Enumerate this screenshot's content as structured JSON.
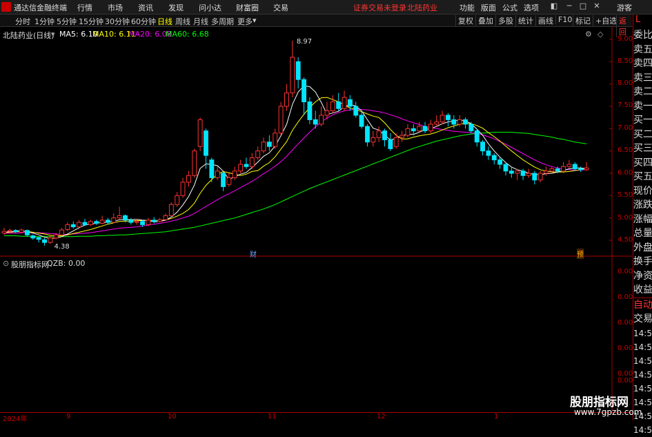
{
  "app": {
    "title": "通达信金融终端",
    "menu": [
      "行情",
      "市场",
      "资讯",
      "发现",
      "问小达",
      "财富圈",
      "交易"
    ],
    "notice": "证券交易未登录",
    "stock_name_top": "北陆药业",
    "right_menu": [
      "功能",
      "版面",
      "公式",
      "选项"
    ],
    "user": "游客"
  },
  "periods": [
    "分时",
    "1分钟",
    "5分钟",
    "15分钟",
    "30分钟",
    "60分钟",
    "日线",
    "周线",
    "月线",
    "多周期",
    "更多"
  ],
  "active_period": "日线",
  "tools": [
    "复权",
    "叠加",
    "多股",
    "统计",
    "画线",
    "F10",
    "标记",
    "+自选",
    "返回"
  ],
  "main_legend": {
    "title": "北陆药业(日线)",
    "ma5": "MA5: 6.10",
    "ma10": "MA10: 6.11",
    "ma20": "MA20: 6.08",
    "ma60": "MA60: 6.68"
  },
  "annotations": {
    "high": "8.97",
    "low": "4.38",
    "fin_mark": "财",
    "pre_mark": "预"
  },
  "price_axis": [
    "9.00",
    "8.50",
    "8.00",
    "7.50",
    "7.00",
    "6.50",
    "6.00",
    "5.50",
    "5.00",
    "4.50"
  ],
  "sub_legend": {
    "title": "股朋指标网",
    "qzb": "QZB: 0.00"
  },
  "sub_axis": [
    "0.00",
    "0.00",
    "0.00",
    "0.00",
    "0.00",
    "0.00"
  ],
  "x_axis": [
    "2024年",
    "9",
    "10",
    "11",
    "12",
    "1"
  ],
  "right_panel": {
    "head": "L",
    "items": [
      "委比",
      "卖五",
      "卖四",
      "卖三",
      "卖二",
      "卖一",
      "买一",
      "买二",
      "买三",
      "买四",
      "买五",
      "现价",
      "涨跌",
      "涨幅",
      "总量",
      "外盘",
      "换手",
      "净资",
      "收益"
    ],
    "auto": "自动",
    "trade": "交易",
    "times": [
      "14:56",
      "14:56",
      "14:56",
      "14:56",
      "14:56",
      "14:56",
      "14:56",
      "14:56"
    ]
  },
  "watermark": {
    "line1": "股朋指标网",
    "line2": "www.7gpzb.com"
  },
  "colors": {
    "up": "#ff3333",
    "down": "#00e5ff",
    "ma5": "#ffffff",
    "ma10": "#ffff00",
    "ma20": "#ff00ff",
    "ma60": "#00ff00",
    "axis": "#aa0000"
  },
  "chart_data": {
    "type": "candlestick",
    "ylim": [
      4.3,
      9.1
    ],
    "candles": [
      [
        4.66,
        4.7,
        4.78,
        4.62
      ],
      [
        4.7,
        4.72,
        4.76,
        4.65
      ],
      [
        4.72,
        4.69,
        4.75,
        4.66
      ],
      [
        4.68,
        4.73,
        4.76,
        4.65
      ],
      [
        4.72,
        4.62,
        4.74,
        4.58
      ],
      [
        4.6,
        4.55,
        4.63,
        4.51
      ],
      [
        4.56,
        4.52,
        4.58,
        4.45
      ],
      [
        4.51,
        4.45,
        4.55,
        4.38
      ],
      [
        4.45,
        4.55,
        4.6,
        4.42
      ],
      [
        4.55,
        4.62,
        4.66,
        4.52
      ],
      [
        4.62,
        4.73,
        4.78,
        4.6
      ],
      [
        4.74,
        4.85,
        4.9,
        4.7
      ],
      [
        4.85,
        4.8,
        4.92,
        4.76
      ],
      [
        4.8,
        4.9,
        4.95,
        4.78
      ],
      [
        4.9,
        4.85,
        4.98,
        4.82
      ],
      [
        4.85,
        4.92,
        4.96,
        4.82
      ],
      [
        4.92,
        4.88,
        4.96,
        4.84
      ],
      [
        4.88,
        4.95,
        5.05,
        4.86
      ],
      [
        4.95,
        4.9,
        5.0,
        4.85
      ],
      [
        4.9,
        5.0,
        5.1,
        4.88
      ],
      [
        5.0,
        5.05,
        5.25,
        4.98
      ],
      [
        5.05,
        4.95,
        5.08,
        4.9
      ],
      [
        4.95,
        4.9,
        5.0,
        4.85
      ],
      [
        4.9,
        4.92,
        4.98,
        4.85
      ],
      [
        4.92,
        4.85,
        4.95,
        4.8
      ],
      [
        4.85,
        4.95,
        5.0,
        4.82
      ],
      [
        4.95,
        4.92,
        5.02,
        4.88
      ],
      [
        4.92,
        4.96,
        5.0,
        4.9
      ],
      [
        4.96,
        5.05,
        5.1,
        4.93
      ],
      [
        5.05,
        5.3,
        5.35,
        5.02
      ],
      [
        5.3,
        5.5,
        5.58,
        5.25
      ],
      [
        5.5,
        5.8,
        5.9,
        5.45
      ],
      [
        5.8,
        5.95,
        6.05,
        5.7
      ],
      [
        5.95,
        6.5,
        6.55,
        5.9
      ],
      [
        6.6,
        7.2,
        7.25,
        6.5
      ],
      [
        6.95,
        6.4,
        7.0,
        6.1
      ],
      [
        6.3,
        5.9,
        6.35,
        5.8
      ],
      [
        5.9,
        6.05,
        6.15,
        5.85
      ],
      [
        6.0,
        5.7,
        6.05,
        5.6
      ],
      [
        5.75,
        5.9,
        6.0,
        5.7
      ],
      [
        5.9,
        6.05,
        6.15,
        5.85
      ],
      [
        6.05,
        6.2,
        6.3,
        6.0
      ],
      [
        6.2,
        6.15,
        6.35,
        6.1
      ],
      [
        6.15,
        6.35,
        6.45,
        6.1
      ],
      [
        6.35,
        6.5,
        6.6,
        6.3
      ],
      [
        6.5,
        6.7,
        6.8,
        6.45
      ],
      [
        6.7,
        6.6,
        6.85,
        6.5
      ],
      [
        6.6,
        6.9,
        7.0,
        6.55
      ],
      [
        6.9,
        7.5,
        7.6,
        6.85
      ],
      [
        7.5,
        7.8,
        8.0,
        7.4
      ],
      [
        7.8,
        8.6,
        8.97,
        7.7
      ],
      [
        8.5,
        8.1,
        8.6,
        7.9
      ],
      [
        8.1,
        7.6,
        8.15,
        7.3
      ],
      [
        7.6,
        7.2,
        7.7,
        7.1
      ],
      [
        7.2,
        7.1,
        7.4,
        7.0
      ],
      [
        7.1,
        7.3,
        7.5,
        7.05
      ],
      [
        7.3,
        7.4,
        7.6,
        7.2
      ],
      [
        7.4,
        7.6,
        7.75,
        7.35
      ],
      [
        7.6,
        7.45,
        7.8,
        7.4
      ],
      [
        7.45,
        7.7,
        7.85,
        7.4
      ],
      [
        7.65,
        7.5,
        7.75,
        7.4
      ],
      [
        7.5,
        7.3,
        7.6,
        7.25
      ],
      [
        7.3,
        7.05,
        7.4,
        7.0
      ],
      [
        7.05,
        6.7,
        7.1,
        6.6
      ],
      [
        6.7,
        6.8,
        6.95,
        6.6
      ],
      [
        6.8,
        6.95,
        7.05,
        6.7
      ],
      [
        6.95,
        6.75,
        7.0,
        6.6
      ],
      [
        6.75,
        6.55,
        6.9,
        6.5
      ],
      [
        6.6,
        6.8,
        6.9,
        6.55
      ],
      [
        6.8,
        6.85,
        6.95,
        6.7
      ],
      [
        6.85,
        7.0,
        7.1,
        6.8
      ],
      [
        7.0,
        6.95,
        7.1,
        6.85
      ],
      [
        6.95,
        7.05,
        7.15,
        6.9
      ],
      [
        7.05,
        6.95,
        7.15,
        6.9
      ],
      [
        6.95,
        7.1,
        7.2,
        6.9
      ],
      [
        7.1,
        7.15,
        7.3,
        7.05
      ],
      [
        7.15,
        7.3,
        7.4,
        7.1
      ],
      [
        7.3,
        7.2,
        7.35,
        7.05
      ],
      [
        7.2,
        7.1,
        7.3,
        7.0
      ],
      [
        7.1,
        7.2,
        7.3,
        7.05
      ],
      [
        7.2,
        7.1,
        7.25,
        7.0
      ],
      [
        7.1,
        6.95,
        7.15,
        6.9
      ],
      [
        6.95,
        6.7,
        7.0,
        6.6
      ],
      [
        6.7,
        6.5,
        6.75,
        6.4
      ],
      [
        6.5,
        6.4,
        6.6,
        6.3
      ],
      [
        6.4,
        6.3,
        6.45,
        6.2
      ],
      [
        6.3,
        6.2,
        6.35,
        6.1
      ],
      [
        6.2,
        6.05,
        6.25,
        5.95
      ],
      [
        6.05,
        6.0,
        6.15,
        5.9
      ],
      [
        6.0,
        6.05,
        6.1,
        5.85
      ],
      [
        6.05,
        5.95,
        6.1,
        5.85
      ],
      [
        5.95,
        6.0,
        6.1,
        5.9
      ],
      [
        6.0,
        5.85,
        6.05,
        5.75
      ],
      [
        5.85,
        6.0,
        6.05,
        5.8
      ],
      [
        6.0,
        6.05,
        6.15,
        5.95
      ],
      [
        6.05,
        6.1,
        6.15,
        6.0
      ],
      [
        6.1,
        6.05,
        6.15,
        6.0
      ],
      [
        6.05,
        6.15,
        6.25,
        6.0
      ],
      [
        6.15,
        6.2,
        6.3,
        6.1
      ],
      [
        6.2,
        6.1,
        6.25,
        6.05
      ],
      [
        6.1,
        6.08,
        6.15,
        6.03
      ],
      [
        6.08,
        6.12,
        6.25,
        6.05
      ]
    ],
    "ma5": [
      4.68,
      4.69,
      4.7,
      4.71,
      4.69,
      4.66,
      4.62,
      4.57,
      4.54,
      4.55,
      4.58,
      4.64,
      4.71,
      4.78,
      4.84,
      4.86,
      4.88,
      4.9,
      4.9,
      4.92,
      4.96,
      4.97,
      4.96,
      4.97,
      4.95,
      4.94,
      4.91,
      4.92,
      4.95,
      5.02,
      5.13,
      5.29,
      5.48,
      5.74,
      6.11,
      6.21,
      6.2,
      6.17,
      6.05,
      5.86,
      5.92,
      5.98,
      6.02,
      6.13,
      6.25,
      6.38,
      6.46,
      6.61,
      6.84,
      7.1,
      7.54,
      7.82,
      7.96,
      7.94,
      7.82,
      7.59,
      7.32,
      7.35,
      7.39,
      7.49,
      7.54,
      7.51,
      7.4,
      7.2,
      7.01,
      6.97,
      6.85,
      6.75,
      6.78,
      6.84,
      6.88,
      6.87,
      6.92,
      6.98,
      7.0,
      7.05,
      7.11,
      7.15,
      7.17,
      7.19,
      7.18,
      7.11,
      6.99,
      6.85,
      6.66,
      6.5,
      6.36,
      6.24,
      6.14,
      6.08,
      6.05,
      6.0,
      5.97,
      5.97,
      5.99,
      6.0,
      6.03,
      6.06,
      6.1,
      6.12,
      6.12,
      6.1
    ],
    "ma10": [
      4.67,
      4.68,
      4.69,
      4.7,
      4.7,
      4.68,
      4.66,
      4.64,
      4.61,
      4.6,
      4.6,
      4.62,
      4.65,
      4.68,
      4.71,
      4.74,
      4.78,
      4.82,
      4.86,
      4.89,
      4.92,
      4.93,
      4.93,
      4.94,
      4.94,
      4.95,
      4.94,
      4.94,
      4.95,
      4.99,
      5.04,
      5.1,
      5.19,
      5.33,
      5.55,
      5.73,
      5.86,
      5.98,
      6.04,
      6.01,
      5.98,
      5.95,
      5.98,
      6.04,
      6.06,
      6.16,
      6.24,
      6.37,
      6.54,
      6.71,
      6.96,
      7.15,
      7.32,
      7.47,
      7.6,
      7.69,
      7.7,
      7.65,
      7.6,
      7.53,
      7.46,
      7.43,
      7.38,
      7.33,
      7.28,
      7.25,
      7.13,
      6.98,
      6.85,
      6.77,
      6.77,
      6.81,
      6.84,
      6.86,
      6.88,
      6.92,
      6.97,
      7.02,
      7.06,
      7.1,
      7.12,
      7.11,
      7.07,
      7.01,
      6.91,
      6.82,
      6.72,
      6.61,
      6.5,
      6.4,
      6.3,
      6.22,
      6.14,
      6.08,
      6.05,
      6.03,
      6.03,
      6.03,
      6.04,
      6.06,
      6.08,
      6.11
    ],
    "ma20": [
      4.65,
      4.66,
      4.66,
      4.67,
      4.67,
      4.67,
      4.67,
      4.66,
      4.65,
      4.64,
      4.63,
      4.63,
      4.64,
      4.65,
      4.66,
      4.67,
      4.69,
      4.71,
      4.73,
      4.75,
      4.77,
      4.78,
      4.79,
      4.8,
      4.82,
      4.84,
      4.86,
      4.88,
      4.9,
      4.93,
      4.96,
      5.0,
      5.04,
      5.1,
      5.18,
      5.26,
      5.33,
      5.41,
      5.48,
      5.54,
      5.61,
      5.68,
      5.75,
      5.82,
      5.9,
      5.99,
      6.07,
      6.16,
      6.26,
      6.38,
      6.52,
      6.66,
      6.79,
      6.92,
      7.04,
      7.15,
      7.24,
      7.31,
      7.36,
      7.4,
      7.42,
      7.43,
      7.43,
      7.42,
      7.4,
      7.38,
      7.35,
      7.31,
      7.27,
      7.22,
      7.17,
      7.13,
      7.09,
      7.05,
      7.02,
      7.0,
      6.98,
      6.96,
      6.94,
      6.93,
      6.92,
      6.91,
      6.89,
      6.86,
      6.82,
      6.77,
      6.71,
      6.65,
      6.58,
      6.51,
      6.44,
      6.37,
      6.3,
      6.24,
      6.19,
      6.15,
      6.12,
      6.09,
      6.08,
      6.07,
      6.07,
      6.08
    ],
    "ma60": [
      4.6,
      4.6,
      4.6,
      4.59,
      4.59,
      4.59,
      4.58,
      4.58,
      4.58,
      4.58,
      4.58,
      4.58,
      4.58,
      4.59,
      4.59,
      4.59,
      4.6,
      4.6,
      4.61,
      4.61,
      4.62,
      4.62,
      4.63,
      4.64,
      4.65,
      4.66,
      4.67,
      4.68,
      4.69,
      4.71,
      4.73,
      4.75,
      4.77,
      4.79,
      4.82,
      4.85,
      4.88,
      4.91,
      4.94,
      4.97,
      5.0,
      5.04,
      5.08,
      5.12,
      5.16,
      5.2,
      5.25,
      5.3,
      5.36,
      5.42,
      5.48,
      5.54,
      5.6,
      5.66,
      5.71,
      5.76,
      5.81,
      5.86,
      5.91,
      5.96,
      6.01,
      6.06,
      6.11,
      6.16,
      6.21,
      6.26,
      6.31,
      6.36,
      6.41,
      6.46,
      6.51,
      6.56,
      6.6,
      6.64,
      6.68,
      6.72,
      6.75,
      6.78,
      6.81,
      6.84,
      6.86,
      6.88,
      6.89,
      6.9,
      6.91,
      6.92,
      6.92,
      6.92,
      6.92,
      6.91,
      6.9,
      6.89,
      6.87,
      6.85,
      6.83,
      6.81,
      6.78,
      6.76,
      6.73,
      6.7,
      6.68,
      6.66
    ]
  }
}
